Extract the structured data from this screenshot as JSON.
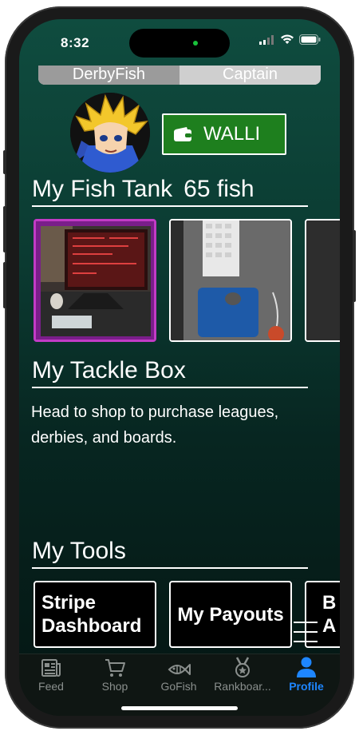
{
  "status": {
    "time": "8:32"
  },
  "segments": [
    {
      "label": "DerbyFish",
      "active": true
    },
    {
      "label": "Captain",
      "active": false
    }
  ],
  "wallet": {
    "label": "WALLI"
  },
  "fish_tank": {
    "title": "My Fish Tank",
    "count": "65 fish"
  },
  "tackle_box": {
    "title": "My Tackle Box",
    "message": "Head to shop to purchase leagues, derbies, and boards."
  },
  "tools": {
    "title": "My Tools",
    "cards": [
      {
        "label": "Stripe Dashboard"
      },
      {
        "label": "My Payouts"
      },
      {
        "label": "B A"
      }
    ]
  },
  "tabs": [
    {
      "label": "Feed",
      "icon": "newspaper-icon"
    },
    {
      "label": "Shop",
      "icon": "cart-icon"
    },
    {
      "label": "GoFish",
      "icon": "fish-icon"
    },
    {
      "label": "Rankboar...",
      "icon": "medal-icon"
    },
    {
      "label": "Profile",
      "icon": "person-icon",
      "active": true
    }
  ],
  "colors": {
    "background_top": "#0f4c3f",
    "background_bottom": "#041512",
    "wallet_green": "#1e7f1e",
    "tab_active": "#1e86ff",
    "tab_inactive": "#8a8f8d"
  }
}
